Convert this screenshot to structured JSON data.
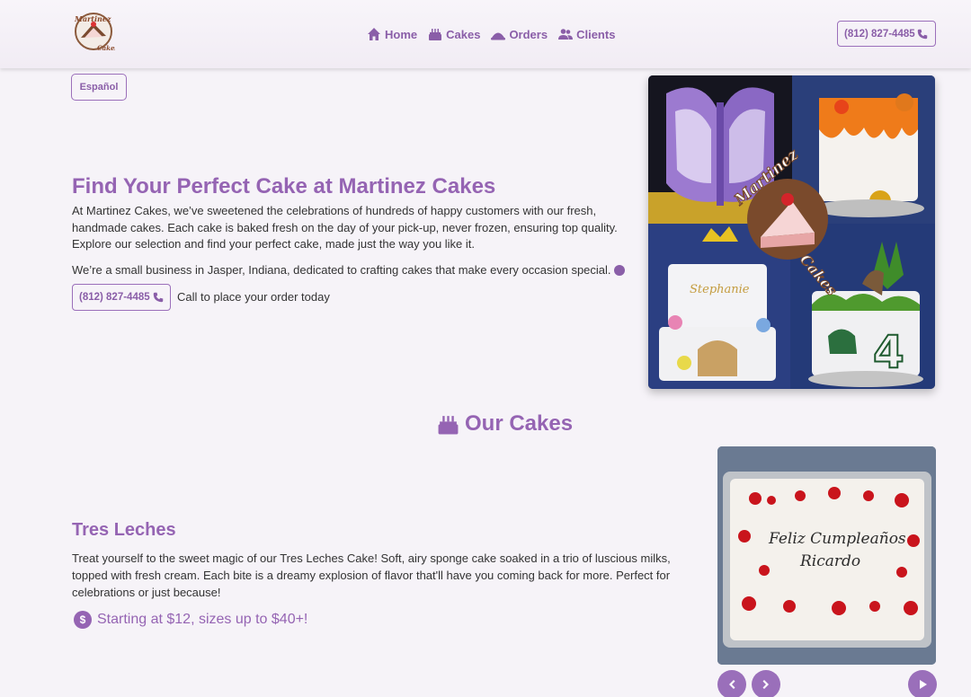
{
  "header": {
    "logo_text_top": "Martinez",
    "logo_text_bottom": "Cakes",
    "nav": [
      {
        "label": "Home",
        "icon": "home-icon"
      },
      {
        "label": "Cakes",
        "icon": "cake-icon"
      },
      {
        "label": "Orders",
        "icon": "orders-icon"
      },
      {
        "label": "Clients",
        "icon": "clients-icon"
      }
    ],
    "phone": "(812) 827-4485"
  },
  "language_button": "Español",
  "hero": {
    "title": "Find Your Perfect Cake at Martinez Cakes",
    "paragraph1": "At Martinez Cakes, we’ve sweetened the celebrations of hundreds of happy customers with our fresh, handmade cakes. Each cake is baked fresh on the day of your pick-up, never frozen, ensuring top quality. Explore our selection and find your perfect cake, made just the way you like it.",
    "paragraph2": "We’re a small business in Jasper, Indiana, dedicated to crafting cakes that make every occasion special.",
    "phone": "(812) 827-4485",
    "call_text": "Call to place your order today",
    "collage_logo_top": "Martinez",
    "collage_logo_bottom": "Cakes",
    "collage_cake_name": "Stephanie"
  },
  "cakes_section": {
    "heading": "Our Cakes",
    "cake": {
      "title": "Tres Leches",
      "description": "Treat yourself to the sweet magic of our Tres Leches Cake! Soft, airy sponge cake soaked in a trio of luscious milks, topped with fresh cream. Each bite is a dreamy explosion of flavor that'll have you coming back for more. Perfect for celebrations or just because!",
      "price": "Starting at $12, sizes up to $40+!",
      "image_text_line1": "Feliz Cumpleaños",
      "image_text_line2": "Ricardo"
    }
  },
  "colors": {
    "accent": "#9564b3",
    "background": "#f6f3f8",
    "text": "#333333"
  }
}
